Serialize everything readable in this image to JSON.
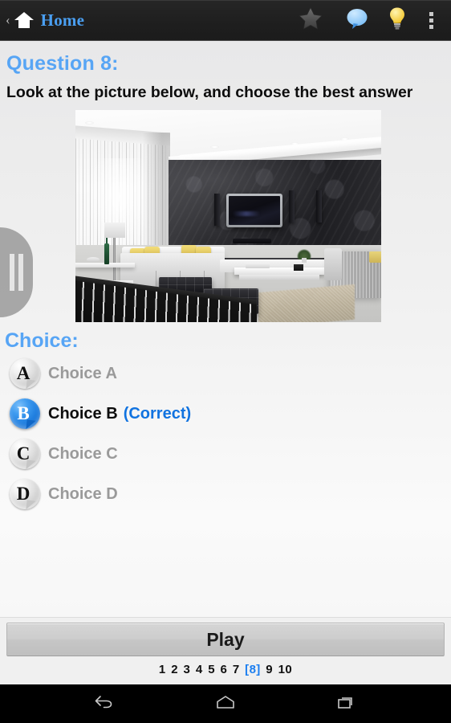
{
  "actionbar": {
    "back_label": "‹",
    "home_label": "Home",
    "icons": {
      "home": "home-icon",
      "star": "star-icon",
      "chat": "chat-bubble-icon",
      "hint": "lightbulb-icon",
      "overflow": "overflow-menu-icon"
    }
  },
  "question": {
    "title": "Question 8:",
    "prompt": "Look at the picture below, and choose the best answer",
    "image_alt": "modern living room with dark feature wall, wall-mounted TV, white sofa with yellow cushions and black tufted benches"
  },
  "choices": {
    "heading": "Choice:",
    "correct_tag": "(Correct)",
    "items": [
      {
        "letter": "A",
        "label": "Choice A",
        "selected": false,
        "correct": false
      },
      {
        "letter": "B",
        "label": "Choice B",
        "selected": true,
        "correct": true
      },
      {
        "letter": "C",
        "label": "Choice C",
        "selected": false,
        "correct": false
      },
      {
        "letter": "D",
        "label": "Choice D",
        "selected": false,
        "correct": false
      }
    ]
  },
  "drawer": {
    "icon": "pause-handle-icon"
  },
  "bottom": {
    "play_label": "Play",
    "pages": [
      "1",
      "2",
      "3",
      "4",
      "5",
      "6",
      "7",
      "8",
      "9",
      "10"
    ],
    "current_page": "8",
    "current_page_display": "[8]"
  },
  "navbar": {
    "back": "back-icon",
    "home": "home-icon",
    "recents": "recents-icon"
  },
  "colors": {
    "accent_blue": "#57a5f5",
    "link_blue": "#1173e0",
    "actionbar_bg": "#1f1f1f",
    "page_bg": "#f3f3f3",
    "muted_text": "#9a9a9a"
  }
}
